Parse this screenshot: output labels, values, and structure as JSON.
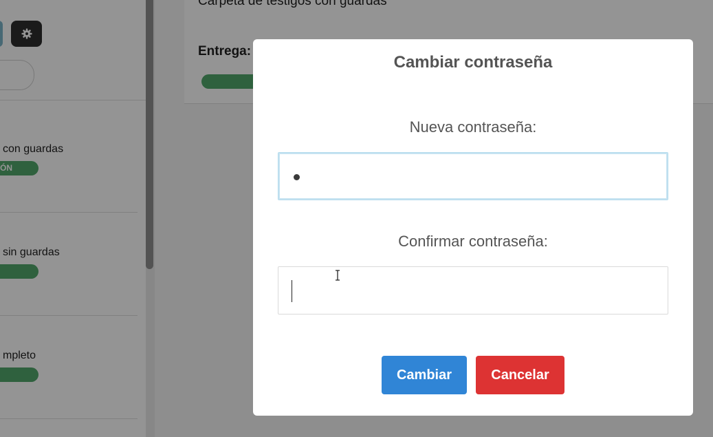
{
  "sidebar": {
    "settings_icon": "gear-icon",
    "items": [
      {
        "title": "con guardas",
        "badge": "ÓN"
      },
      {
        "title": "sin guardas",
        "badge": ""
      },
      {
        "title": "mpleto",
        "badge": ""
      }
    ]
  },
  "main": {
    "title": "Carpeta de testigos con guardas",
    "label": "Entrega:"
  },
  "modal": {
    "title": "Cambiar contraseña",
    "new_password_label": "Nueva contraseña:",
    "confirm_password_label": "Confirmar contraseña:",
    "confirm_button": "Cambiar",
    "cancel_button": "Cancelar"
  },
  "colors": {
    "confirm": "#3085d6",
    "cancel": "#dd3333",
    "badge": "#52a86c",
    "overlay": "rgba(0,0,0,0.42)"
  }
}
